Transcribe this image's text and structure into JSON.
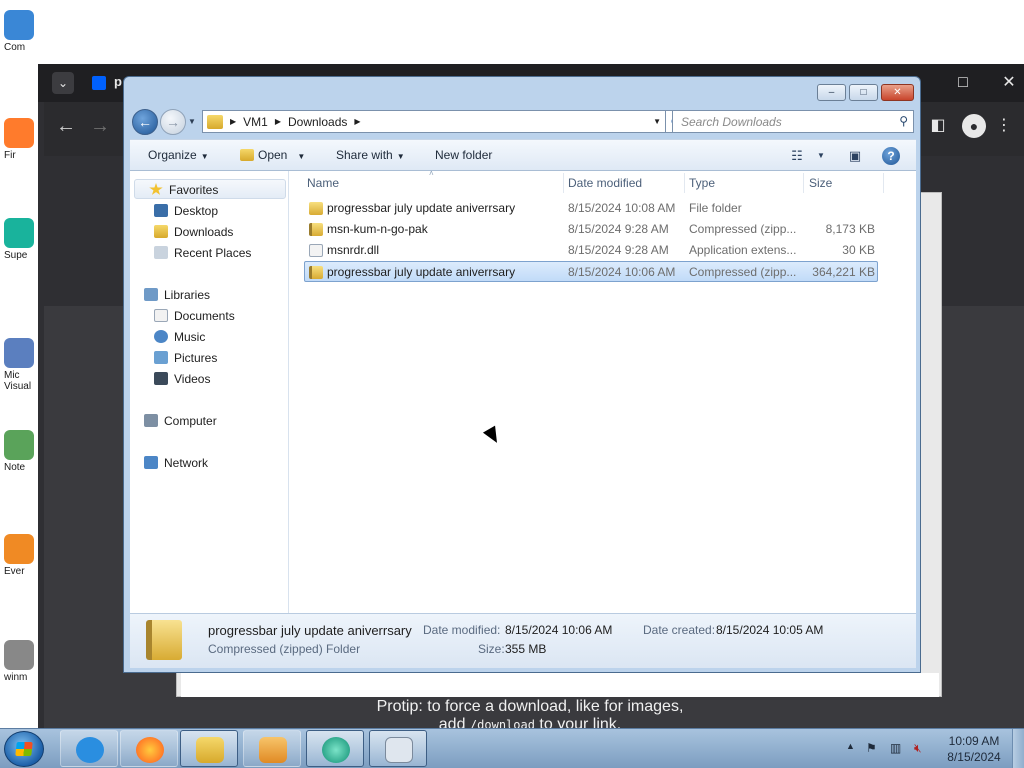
{
  "desktop": {
    "icons": [
      {
        "label": "Com",
        "icon": "computer-icon",
        "color": "#3a87d6"
      },
      {
        "label": "Fir",
        "icon": "firefox-icon",
        "color": "#ff7b2c"
      },
      {
        "label": "Supe",
        "icon": "superbrowser-icon",
        "color": "#19b39c"
      },
      {
        "label": "Mic Visual",
        "icon": "visual-studio-icon",
        "color": "#5b7fbf"
      },
      {
        "label": "Note",
        "icon": "notepad-icon",
        "color": "#5aa35a"
      },
      {
        "label": "Ever",
        "icon": "everything-icon",
        "color": "#f08a24"
      },
      {
        "label": "winm",
        "icon": "winamp-icon",
        "color": "#888888"
      }
    ]
  },
  "browser": {
    "tab_initial": "p",
    "protip": {
      "line1": "Protip: to force a download, like for images,",
      "line2_pre": "add ",
      "line2_code": "/download",
      "line2_post": " to your link."
    }
  },
  "explorer": {
    "caption_buttons": {
      "minimize": "–",
      "maximize": "□",
      "close": "✕"
    },
    "breadcrumb": [
      "VM1",
      "Downloads"
    ],
    "search_placeholder": "Search Downloads",
    "commands": {
      "organize": "Organize",
      "open": "Open",
      "share_with": "Share with",
      "new_folder": "New folder"
    },
    "nav": {
      "favorites": "Favorites",
      "favorites_items": [
        "Desktop",
        "Downloads",
        "Recent Places"
      ],
      "libraries": "Libraries",
      "libraries_items": [
        "Documents",
        "Music",
        "Pictures",
        "Videos"
      ],
      "computer": "Computer",
      "network": "Network"
    },
    "columns": {
      "name": "Name",
      "date": "Date modified",
      "type": "Type",
      "size": "Size"
    },
    "files": [
      {
        "name": "progressbar july update aniverrsary",
        "date": "8/15/2024 10:08 AM",
        "type": "File folder",
        "size": "",
        "kind": "folder"
      },
      {
        "name": "msn-kum-n-go-pak",
        "date": "8/15/2024 9:28 AM",
        "type": "Compressed (zipp...",
        "size": "8,173 KB",
        "kind": "zip"
      },
      {
        "name": "msnrdr.dll",
        "date": "8/15/2024 9:28 AM",
        "type": "Application extens...",
        "size": "30 KB",
        "kind": "dll"
      },
      {
        "name": "progressbar july update aniverrsary",
        "date": "8/15/2024 10:06 AM",
        "type": "Compressed (zipp...",
        "size": "364,221 KB",
        "kind": "zip",
        "selected": true
      }
    ],
    "details": {
      "name": "progressbar july update aniverrsary",
      "type": "Compressed (zipped) Folder",
      "date_modified_label": "Date modified:",
      "date_modified": "8/15/2024 10:06 AM",
      "date_created_label": "Date created:",
      "date_created": "8/15/2024 10:05 AM",
      "size_label": "Size:",
      "size": "355 MB"
    }
  },
  "taskbar": {
    "clock_time": "10:09 AM",
    "clock_date": "8/15/2024",
    "pinned": [
      {
        "icon": "internet-explorer-icon",
        "color": "#2a8ee0"
      },
      {
        "icon": "firefox-icon",
        "color": "#ff7b2c"
      },
      {
        "icon": "file-explorer-icon",
        "color": "#e8c25a"
      },
      {
        "icon": "media-player-icon",
        "color": "#f0a23a"
      },
      {
        "icon": "superbrowser-icon",
        "color": "#19b39c"
      },
      {
        "icon": "magnifier-document-icon",
        "color": "#9aa7b7"
      }
    ]
  }
}
